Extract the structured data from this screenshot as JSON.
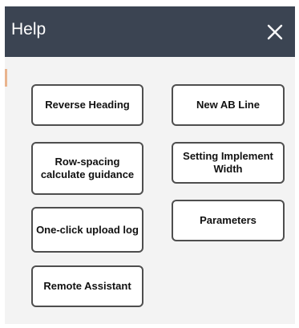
{
  "dialog": {
    "title": "Help",
    "close_icon": "close-icon",
    "colors": {
      "titlebar_bg": "#3b4452",
      "titlebar_text": "#ffffff",
      "body_bg": "#f3f3f3",
      "button_border": "#4e4e4e",
      "button_bg": "#ffffff"
    }
  },
  "buttons": {
    "reverse_heading": "Reverse Heading",
    "new_ab_line": "New AB Line",
    "row_spacing": "Row-spacing calculate guidance",
    "setting_implement_width": "Setting Implement Width",
    "one_click_upload_log": "One-click upload log",
    "parameters": "Parameters",
    "remote_assistant": "Remote Assistant"
  }
}
